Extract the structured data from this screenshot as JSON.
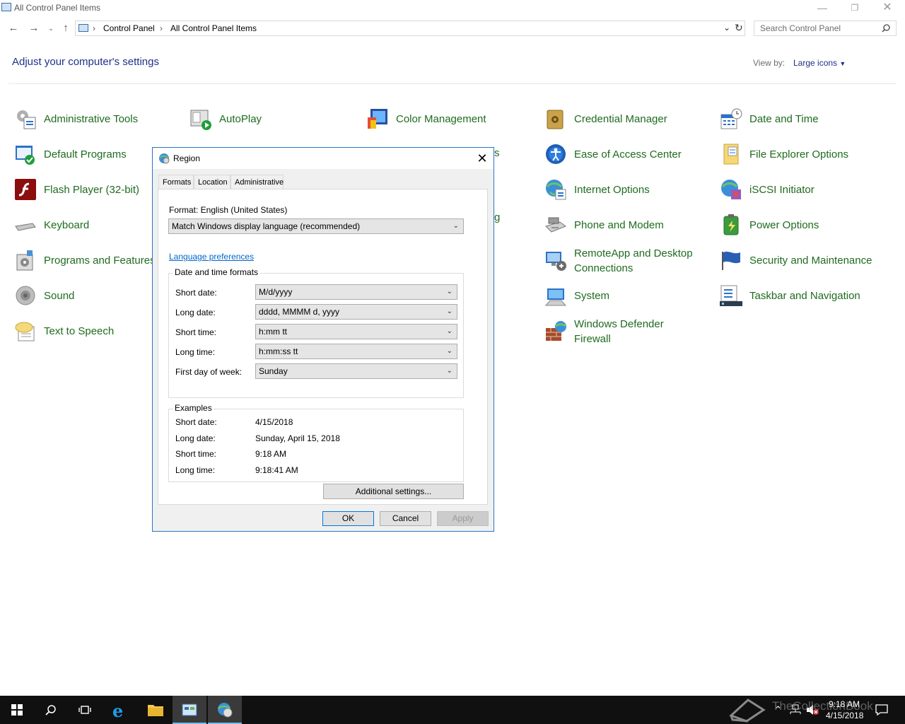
{
  "window": {
    "title": "All Control Panel Items"
  },
  "window_controls": {
    "minimize": "—",
    "restore": "❐",
    "close": "✕"
  },
  "address": {
    "crumbs": [
      "Control Panel",
      "All Control Panel Items"
    ],
    "separator": "›",
    "search_placeholder": "Search Control Panel"
  },
  "header": {
    "heading": "Adjust your computer's settings",
    "view_by_label": "View by:",
    "view_by_value": "Large icons"
  },
  "items": [
    {
      "label": "Administrative Tools",
      "icon": "admin-tools-icon"
    },
    {
      "label": "AutoPlay",
      "icon": "autoplay-icon"
    },
    {
      "label": "Color Management",
      "icon": "color-management-icon"
    },
    {
      "label": "Credential Manager",
      "icon": "credential-manager-icon"
    },
    {
      "label": "Date and Time",
      "icon": "date-time-icon"
    },
    {
      "label": "Default Programs",
      "icon": "default-programs-icon"
    },
    {
      "label": "Ease of Access Center",
      "icon": "ease-of-access-icon"
    },
    {
      "label": "File Explorer Options",
      "icon": "file-explorer-options-icon"
    },
    {
      "label": "Flash Player (32-bit)",
      "icon": "flash-player-icon"
    },
    {
      "label": "Internet Options",
      "icon": "internet-options-icon"
    },
    {
      "label": "iSCSI Initiator",
      "icon": "iscsi-icon"
    },
    {
      "label": "Keyboard",
      "icon": "keyboard-icon"
    },
    {
      "label": "Phone and Modem",
      "icon": "phone-modem-icon"
    },
    {
      "label": "Power Options",
      "icon": "power-options-icon"
    },
    {
      "label": "Programs and Features",
      "icon": "programs-features-icon"
    },
    {
      "label": "RemoteApp and Desktop",
      "label2": "Connections",
      "icon": "remoteapp-icon"
    },
    {
      "label": "Security and Maintenance",
      "icon": "security-maintenance-icon"
    },
    {
      "label": "Sound",
      "icon": "sound-icon"
    },
    {
      "label": "System",
      "icon": "system-icon"
    },
    {
      "label": "Taskbar and Navigation",
      "icon": "taskbar-icon"
    },
    {
      "label": "Text to Speech",
      "icon": "text-to-speech-icon"
    },
    {
      "label": "Windows Defender",
      "label2": "Firewall",
      "icon": "firewall-icon"
    }
  ],
  "partial_labels": {
    "p1": "s",
    "p2": "g"
  },
  "dialog": {
    "title": "Region",
    "close": "✕",
    "tabs": [
      "Formats",
      "Location",
      "Administrative"
    ],
    "format_label": "Format: English (United States)",
    "format_value": "Match Windows display language (recommended)",
    "language_link": "Language preferences",
    "dt_group": "Date and time formats",
    "fields": [
      {
        "label": "Short date:",
        "value": "M/d/yyyy"
      },
      {
        "label": "Long date:",
        "value": "dddd, MMMM d, yyyy"
      },
      {
        "label": "Short time:",
        "value": "h:mm tt"
      },
      {
        "label": "Long time:",
        "value": "h:mm:ss tt"
      },
      {
        "label": "First day of week:",
        "value": "Sunday"
      }
    ],
    "examples_group": "Examples",
    "examples": [
      {
        "label": "Short date:",
        "value": "4/15/2018"
      },
      {
        "label": "Long date:",
        "value": "Sunday, April 15, 2018"
      },
      {
        "label": "Short time:",
        "value": "9:18 AM"
      },
      {
        "label": "Long time:",
        "value": "9:18:41 AM"
      }
    ],
    "additional_button": "Additional settings...",
    "ok": "OK",
    "cancel": "Cancel",
    "apply": "Apply"
  },
  "taskbar": {
    "clock_time": "9:18 AM",
    "clock_date": "4/15/2018",
    "watermark": "TheCollectionBook"
  }
}
